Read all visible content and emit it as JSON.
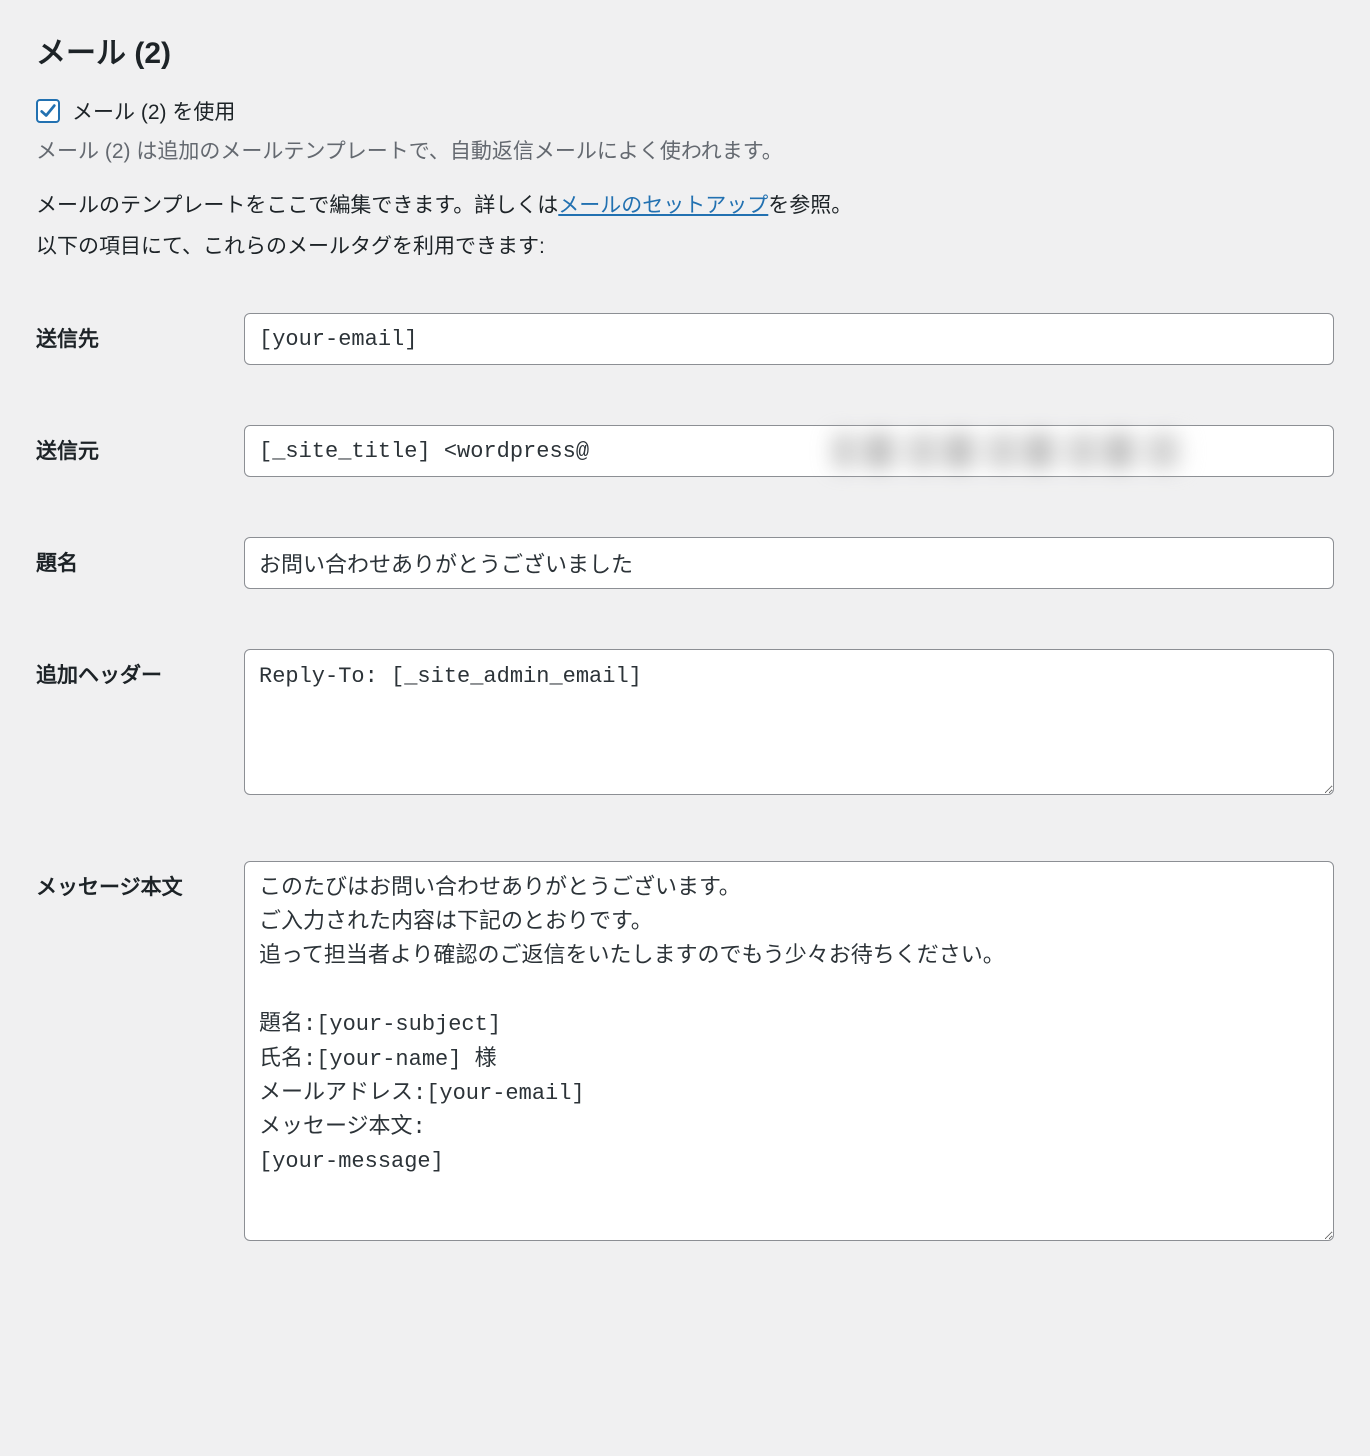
{
  "section": {
    "title": "メール (2)",
    "checkbox_label": "メール (2) を使用",
    "checkbox_checked": true
  },
  "intro": {
    "gray_note": "メール (2) は追加のメールテンプレートで、自動返信メールによく使われます。",
    "line1_prefix": "メールのテンプレートをここで編集できます。詳しくは",
    "line1_link": "メールのセットアップ",
    "line1_suffix": "を参照。",
    "line2": "以下の項目にて、これらのメールタグを利用できます:"
  },
  "fields": {
    "to": {
      "label": "送信先",
      "value": "[your-email]"
    },
    "from": {
      "label": "送信元",
      "value": "[_site_title] <wordpress@"
    },
    "subject": {
      "label": "題名",
      "value": "お問い合わせありがとうございました"
    },
    "headers": {
      "label": "追加ヘッダー",
      "value": "Reply-To: [_site_admin_email]"
    },
    "body": {
      "label": "メッセージ本文",
      "value": "このたびはお問い合わせありがとうございます。\nご入力された内容は下記のとおりです。\n追って担当者より確認のご返信をいたしますのでもう少々お待ちください。\n\n題名:[your-subject]\n氏名:[your-name] 様\nメールアドレス:[your-email]\nメッセージ本文:\n[your-message]"
    }
  }
}
